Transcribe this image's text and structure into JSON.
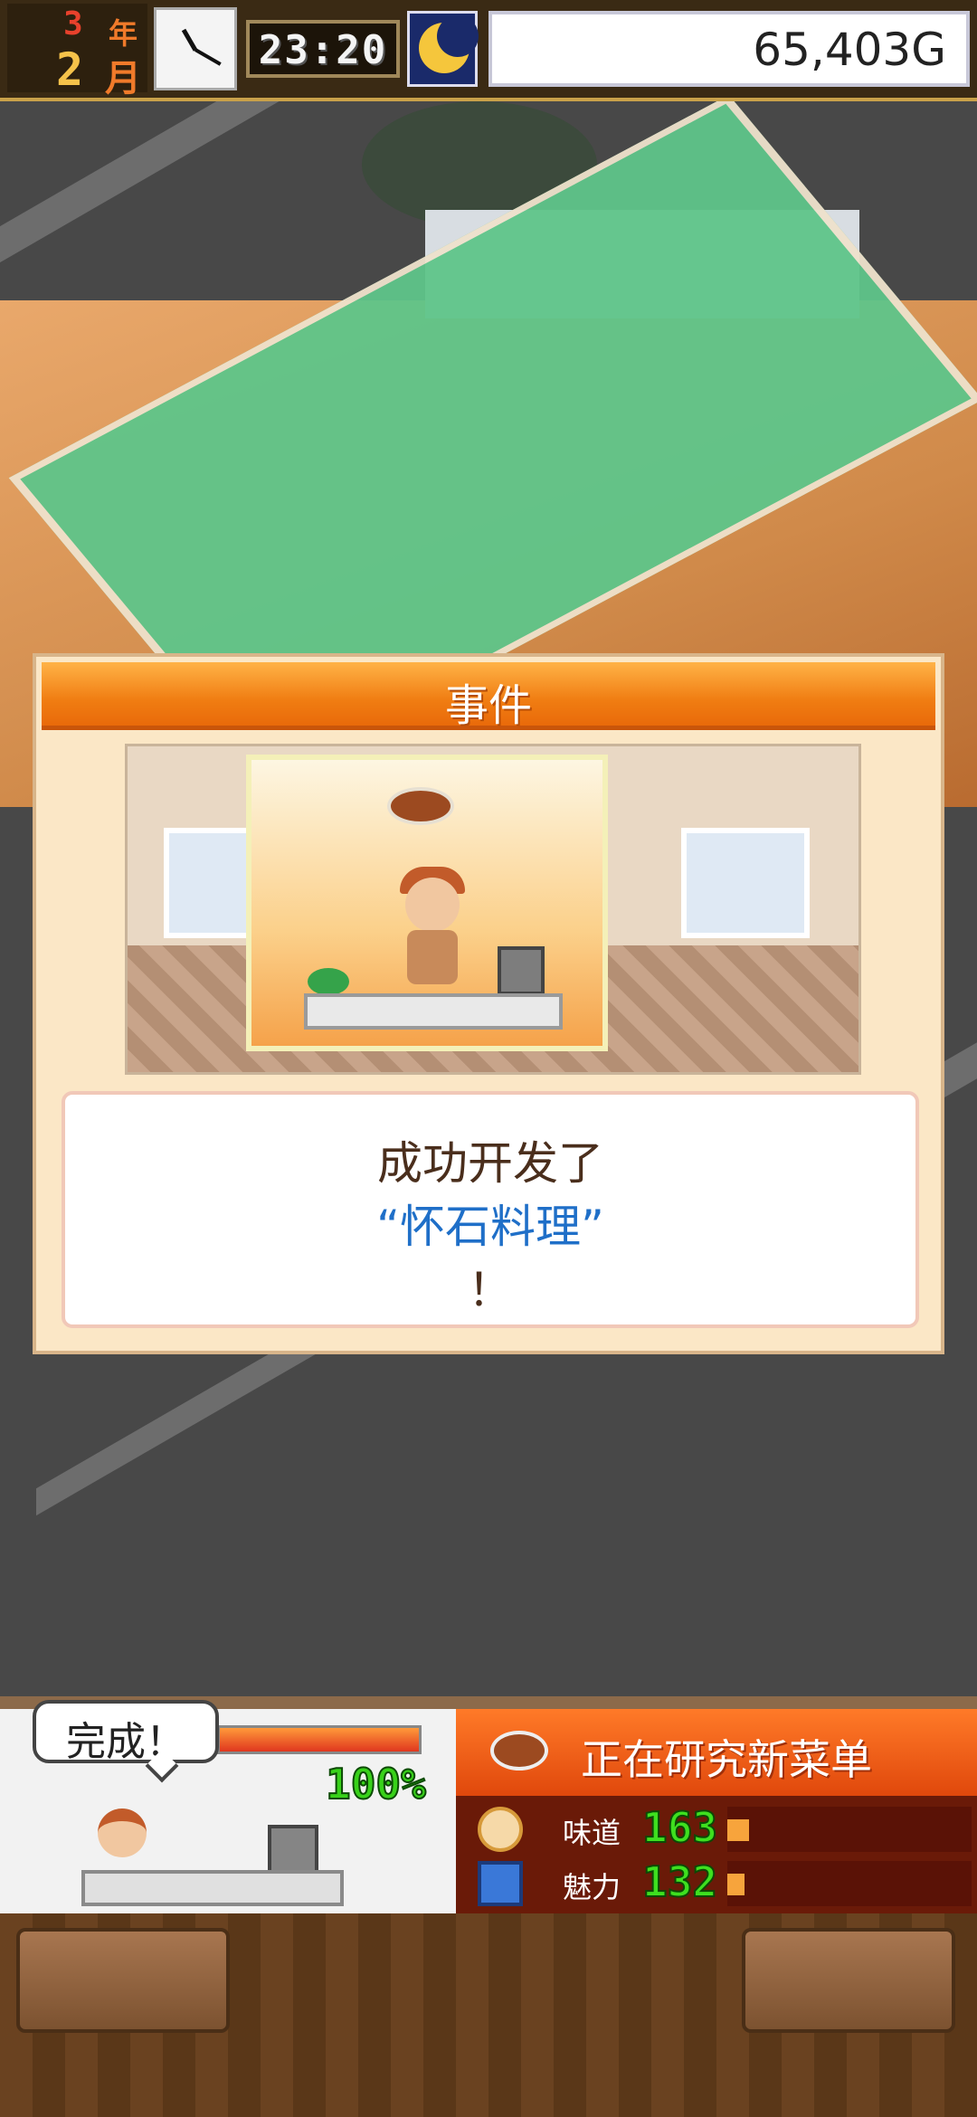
{
  "top_bar": {
    "year_num": "3",
    "year_unit": "年",
    "month_num": "2",
    "month_unit": "月",
    "time": "23:20",
    "money": "65,403G",
    "icons": [
      "clock-icon",
      "moon-icon"
    ]
  },
  "event_dialog": {
    "title": "事件",
    "message_line1": "成功开发了",
    "message_dish": "“怀石料理”",
    "message_line3": "！"
  },
  "status_panel": {
    "bubble_text": "完成！",
    "progress_label": "100%",
    "progress": 1.0,
    "info_title": "正在研究新菜单",
    "stats": [
      {
        "label": "味道",
        "value": "163",
        "bar_fraction": 0.09
      },
      {
        "label": "魅力",
        "value": "132",
        "bar_fraction": 0.07
      }
    ]
  },
  "colors": {
    "accent_orange": "#f07d12",
    "dish_name_blue": "#1f6fc8",
    "stat_green": "#3ee01f"
  }
}
